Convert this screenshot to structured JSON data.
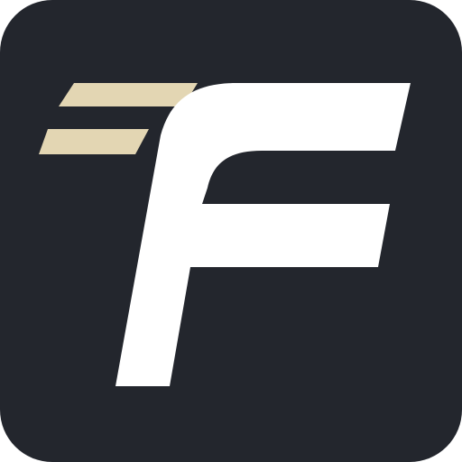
{
  "icon": {
    "name": "F",
    "glyph": "f-letter-icon",
    "colors": {
      "background": "#23262d",
      "letter": "#ffffff",
      "speed_lines": "#e3d6b3"
    }
  }
}
